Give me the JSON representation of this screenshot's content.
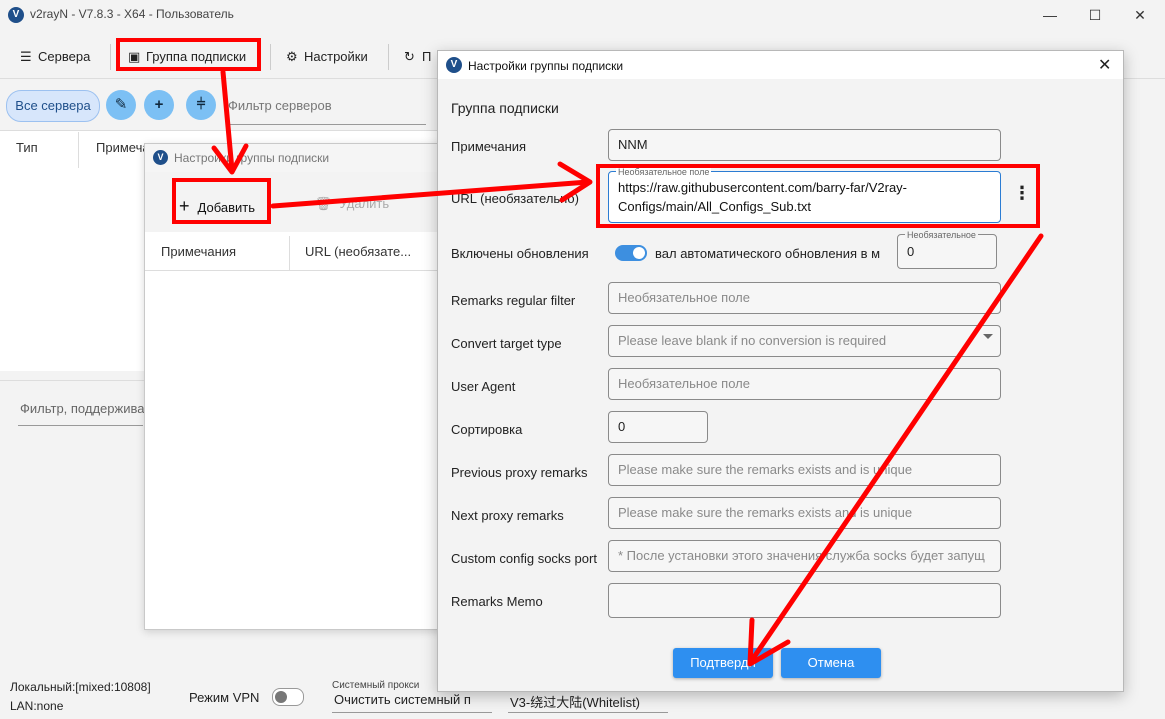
{
  "window": {
    "title": "v2rayN - V7.8.3 - X64 - Пользователь",
    "logo_letter": "V",
    "min": "—",
    "max": "☐",
    "close": "✕"
  },
  "toolbar": {
    "servers": "Сервера",
    "subscription_group": "Группа подписки",
    "settings": "Настройки",
    "truncated": "П"
  },
  "filter": {
    "all_servers": "Все сервера",
    "edit_icon": "✎",
    "add_icon": "+",
    "split_icon": "⫩",
    "placeholder": "Фильтр серверов"
  },
  "table": {
    "col_type": "Тип",
    "col_remarks": "Примеча"
  },
  "lower": {
    "filter_placeholder": "Фильтр, поддержива"
  },
  "status": {
    "local": "Локальный:[mixed:10808]",
    "lan": "LAN:none",
    "vpn_mode": "Режим VPN",
    "sysproxy_label": "Системный прокси",
    "sysproxy_value": "Очистить системный п",
    "routing": "V3-绕过大陆(Whitelist)"
  },
  "sub_dialog": {
    "title": "Настройки группы подписки",
    "add": "Добавить",
    "delete": "Удалить",
    "col_remarks": "Примечания",
    "col_url": "URL (необязате..."
  },
  "edit_dialog": {
    "title": "Настройки группы подписки",
    "close": "✕",
    "section": "Группа подписки",
    "remarks_label": "Примечания",
    "remarks_value": "NNM",
    "url_label": "URL (необязательно)",
    "url_hint": "Необязательное поле",
    "url_value": "https://raw.githubusercontent.com/barry-far/V2ray-Configs/main/All_Configs_Sub.txt",
    "updates_label": "Включены обновления",
    "interval_label": "вал автоматического обновления в м",
    "interval_hint": "Необязательное",
    "interval_value": "0",
    "remarks_filter_label": "Remarks regular filter",
    "remarks_filter_ph": "Необязательное поле",
    "convert_label": "Convert target type",
    "convert_ph": "Please leave blank if no conversion is required",
    "ua_label": "User Agent",
    "ua_ph": "Необязательное поле",
    "sort_label": "Сортировка",
    "sort_value": "0",
    "prev_label": "Previous proxy remarks",
    "prev_ph": "Please make sure the remarks exists and is unique",
    "next_label": "Next proxy remarks",
    "next_ph": "Please make sure the remarks exists and is unique",
    "socks_label": "Custom config socks port",
    "socks_ph": "* После установки этого значения служба socks будет запущ",
    "memo_label": "Remarks Memo",
    "memo_value": "",
    "confirm": "Подтверди",
    "cancel": "Отмена",
    "more_icon": "⋮"
  },
  "colors": {
    "accent": "#2e8ff0",
    "annotation": "#ff0000"
  }
}
